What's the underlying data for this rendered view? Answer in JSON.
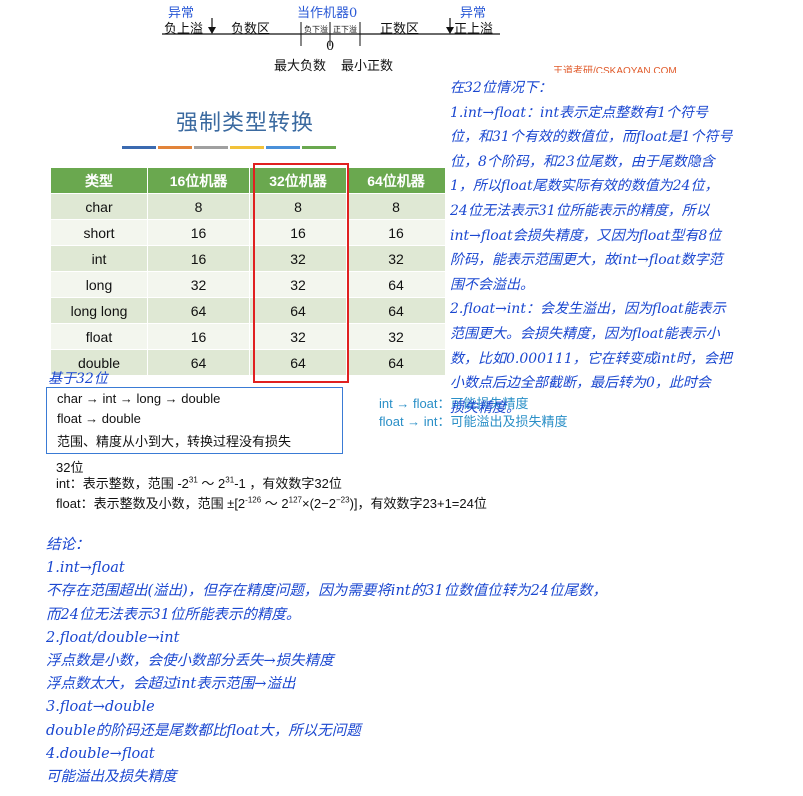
{
  "number_line": {
    "abnormal_left": "异常",
    "neg_overflow": "负上溢",
    "neg_area": "负数区",
    "machine_zero": "当作机器0",
    "neg_underflow": "负下溢",
    "pos_underflow": "正下溢",
    "pos_area": "正数区",
    "abnormal_right": "异常",
    "pos_overflow": "正上溢",
    "zero": "0",
    "max_negative": "最大负数",
    "min_positive": "最小正数",
    "watermark": "王道考研/CSKAOYAN.COM"
  },
  "title": "强制类型转换",
  "color_bar": [
    "#3b6ab0",
    "#e2843a",
    "#a0a0a0",
    "#f2c23a",
    "#4a90d9",
    "#6aa84f"
  ],
  "table": {
    "headers": [
      "类型",
      "16位机器",
      "32位机器",
      "64位机器"
    ],
    "rows": [
      [
        "char",
        "8",
        "8",
        "8"
      ],
      [
        "short",
        "16",
        "16",
        "16"
      ],
      [
        "int",
        "16",
        "32",
        "32"
      ],
      [
        "long",
        "32",
        "32",
        "64"
      ],
      [
        "long long",
        "64",
        "64",
        "64"
      ],
      [
        "float",
        "16",
        "32",
        "32"
      ],
      [
        "double",
        "64",
        "64",
        "64"
      ]
    ]
  },
  "note_32": "基于32位",
  "box": {
    "line1": "char → int → long → double",
    "line2": "float → double",
    "line3": "范围、精度从小到大，转换过程没有损失"
  },
  "right_notes": {
    "int_to_float": "int → float：可能损失精度",
    "float_to_int": "float → int：可能溢出及损失精度"
  },
  "info": {
    "heading": "32位",
    "int_prefix": "int：表示整数，范围 -2",
    "int_exp1": "31",
    "int_mid": " ～ 2",
    "int_exp2": "31",
    "int_suffix": "-1 ，有效数字32位",
    "float_prefix": "float：表示整数及小数，范围 ±[2",
    "float_exp1": "-126",
    "float_mid": " ～ 2",
    "float_exp2": "127",
    "float_mid2": "×(2−2",
    "float_exp3": "−23",
    "float_suffix": ")]，有效数字23+1=24位"
  },
  "handwritten_right": [
    "在32位情况下：",
    "1.int→float：int表示定点整数有1个符号",
    "位，和31个有效的数值位，而float是1个符号",
    "位，8个阶码，和23位尾数，由于尾数隐含",
    "1，所以float尾数实际有效的数值为24位，",
    "24位无法表示31位所能表示的精度，所以",
    "int→float会损失精度，又因为float型有8位",
    "阶码，能表示范围更大，故int→float数字范",
    "围不会溢出。",
    "2.float→int：会发生溢出，因为float能表示",
    "范围更大。会损失精度，因为float能表示小",
    "数，比如0.000111，它在转变成int时，会把",
    "小数点后边全部截断，最后转为0，此时会",
    "损失精度。"
  ],
  "handwritten_bottom": [
    "结论：",
    "1.int→float",
    "不存在范围超出(溢出)，但存在精度问题，因为需要将int的31位数值位转为24位尾数，",
    "而24位无法表示31位所能表示的精度。",
    "2.float/double→int",
    "浮点数是小数，会使小数部分丢失→损失精度",
    "浮点数太大，会超过int表示范围→溢出",
    "3.float→double",
    "double的阶码还是尾数都比float大，所以无问题",
    "4.double→float",
    "可能溢出及损失精度"
  ]
}
